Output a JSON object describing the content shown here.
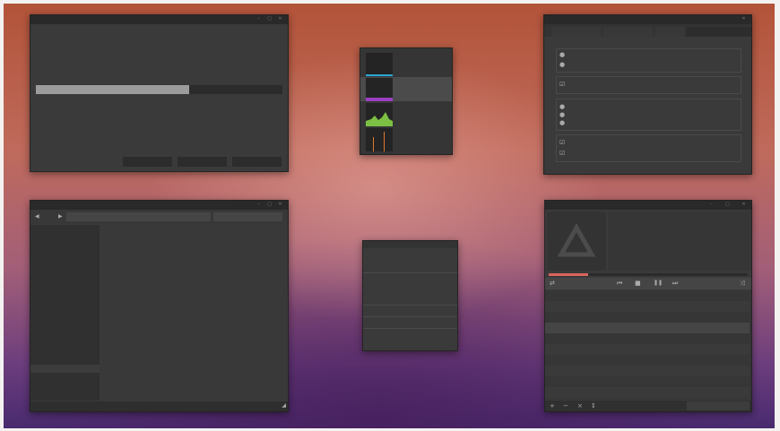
{
  "desktop": {
    "title": ""
  },
  "progress_window": {
    "progress_fraction": 0.62,
    "buttons": [
      "",
      "",
      ""
    ]
  },
  "settings_window": {
    "tabs": [
      "",
      "",
      "",
      ""
    ],
    "groups": 4,
    "radio_glyph": "●",
    "checkbox_glyph": "☑"
  },
  "file_manager": {
    "back_glyph": "◀",
    "forward_glyph": "▶",
    "path": ""
  },
  "graph_switcher": {
    "items": [
      {
        "color": "#2aa9d6"
      },
      {
        "color": "#9a3fc2"
      },
      {
        "color": "#7bc043"
      },
      {
        "color": "#e07a2c"
      }
    ],
    "selected_index": 1
  },
  "media_player": {
    "controls": {
      "prev": "⏮",
      "stop": "■",
      "pause": "❚❚",
      "next": "⏭",
      "repeat": "⇄",
      "shuffle": "⤨"
    },
    "footer": {
      "add": "+",
      "remove": "−",
      "clear": "×",
      "sort": "↕"
    },
    "progress_fraction": 0.2,
    "accent_color": "#d9645a"
  },
  "colors": {
    "window_bg": "#3a3a3a",
    "titlebar": "#292929"
  }
}
